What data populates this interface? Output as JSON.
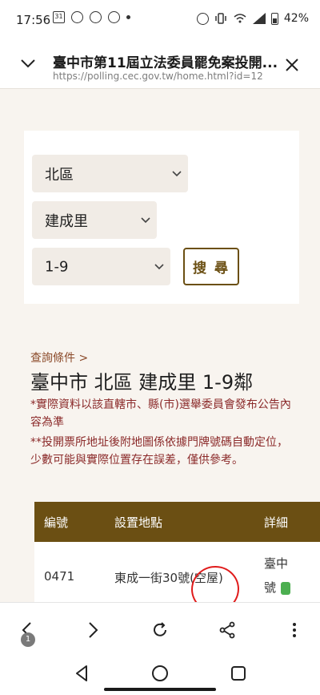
{
  "status_bar": {
    "time": "17:56",
    "calendar_day": "31",
    "battery": "42%",
    "icons": [
      "calendar-icon",
      "alarm-icon",
      "threads-icon",
      "threads-icon",
      "dot-icon",
      "alarm-icon",
      "vibrate-icon",
      "wifi-call-icon",
      "signal-icon",
      "battery-icon"
    ]
  },
  "browser": {
    "title": "臺中市第11屆立法委員罷免案投開...",
    "url": "https://polling.cec.gov.tw/home.html?id=12"
  },
  "filters": {
    "district": "北區",
    "village": "建成里",
    "neighborhood": "1-9",
    "search_label": "搜 尋"
  },
  "results": {
    "criteria_label": "查詢條件 >",
    "title": "臺中市 北區 建成里 1-9鄰",
    "note1": "*實際資料以該直轄市、縣(市)選舉委員會發布公告內容為準",
    "note2": "**投開票所地址後附地圖係依據門牌號碼自動定位，少數可能與實際位置存在誤差，僅供參考。"
  },
  "table": {
    "headers": [
      "編號",
      "設置地點",
      "詳細"
    ],
    "rows": [
      {
        "id": "0471",
        "location": "東成一街30號(空屋)",
        "detail_line1": "臺中",
        "detail_line2": "號"
      }
    ]
  },
  "colors": {
    "brand": "#6b4f13",
    "note_text": "#8b2a2a",
    "annotation": "#e01b1b"
  },
  "bottom_bar": {
    "tab_badge": "1"
  }
}
